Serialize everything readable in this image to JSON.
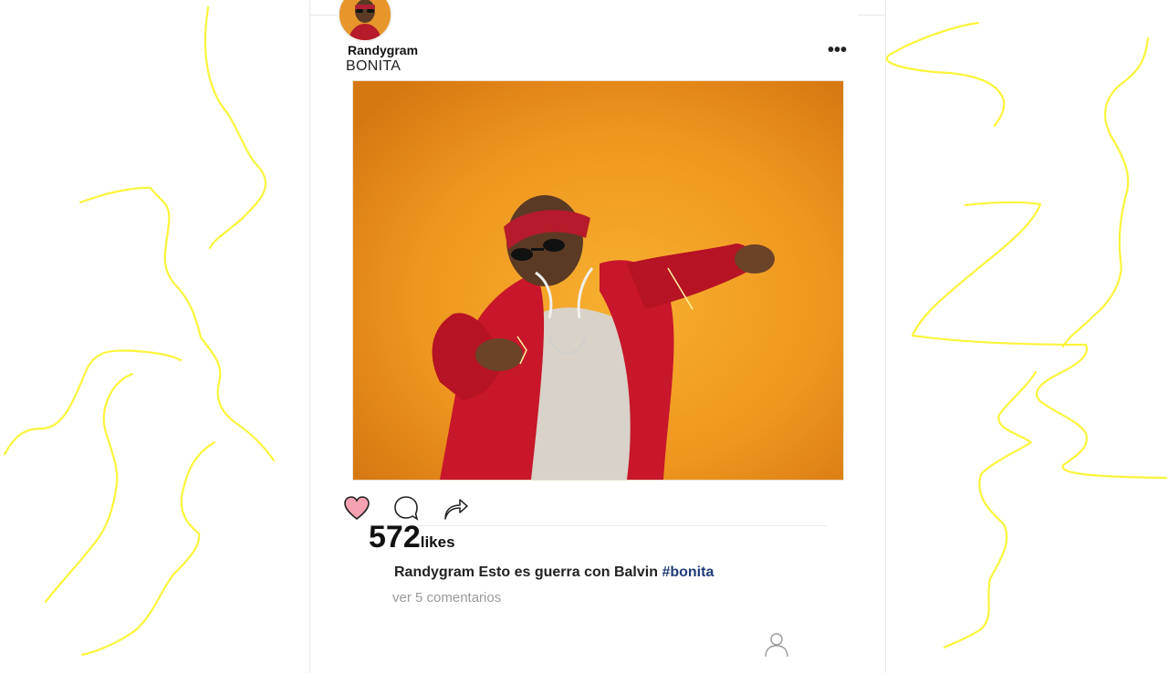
{
  "post": {
    "username": "Randygram",
    "title": "BONITA",
    "more_label": "•••",
    "likes_count": "572",
    "likes_label": "likes",
    "caption_user": "Randygram",
    "caption_text": "Esto es guerra con Balvin",
    "caption_hashtag": "#bonita",
    "view_comments": "ver 5 comentarios",
    "liked": true
  },
  "icons": {
    "avatar": "user-avatar",
    "more": "more-dots-icon",
    "like": "heart-icon",
    "comment": "comment-bubble-icon",
    "share": "share-arrow-icon",
    "profile": "profile-icon"
  },
  "colors": {
    "doodle": "#fbf43a",
    "heart_fill": "#f6a2b2",
    "hashtag": "#1f3c78",
    "image_background": "#ef951d",
    "jacket": "#c8162a"
  }
}
